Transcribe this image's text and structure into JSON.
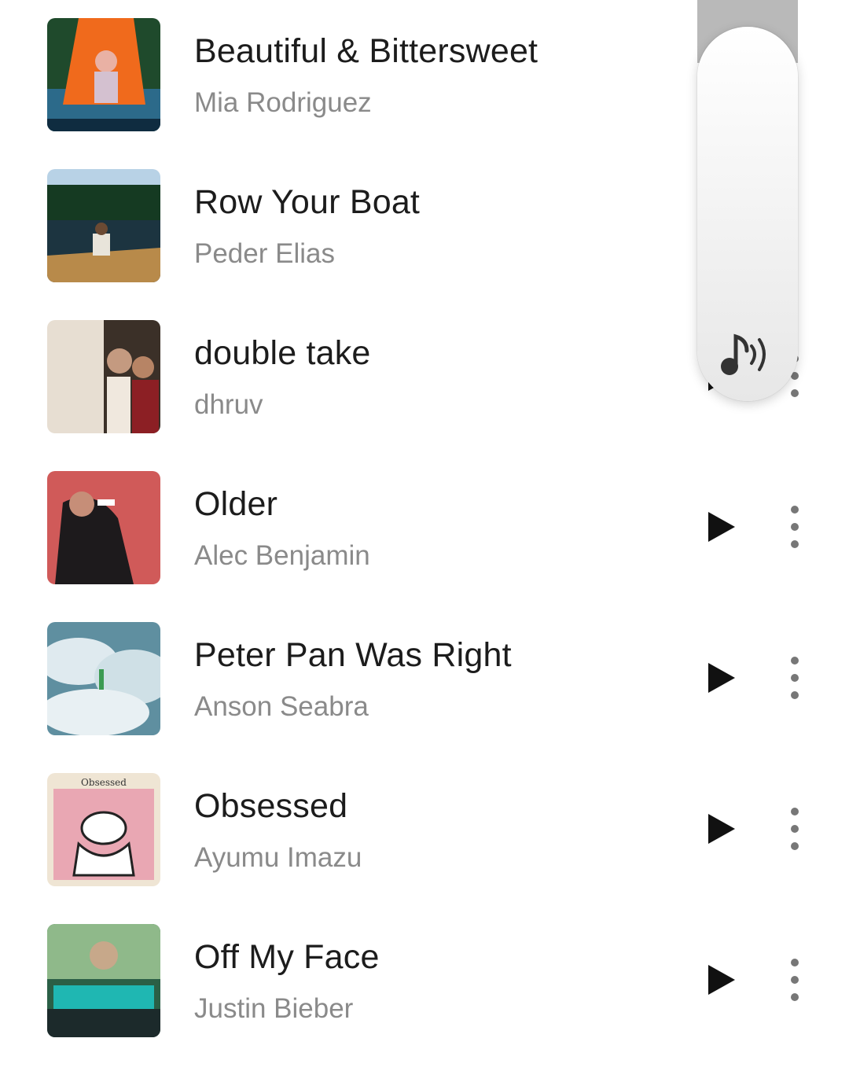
{
  "songs": [
    {
      "title": "Beautiful & Bittersweet",
      "artist": "Mia Rodriguez",
      "art_icon": "album-cover-beautiful-bittersweet"
    },
    {
      "title": "Row Your Boat",
      "artist": "Peder Elias",
      "art_icon": "album-cover-row-your-boat"
    },
    {
      "title": "double take",
      "artist": "dhruv",
      "art_icon": "album-cover-double-take"
    },
    {
      "title": "Older",
      "artist": "Alec Benjamin",
      "art_icon": "album-cover-older"
    },
    {
      "title": "Peter Pan Was Right",
      "artist": "Anson Seabra",
      "art_icon": "album-cover-peter-pan-was-right"
    },
    {
      "title": "Obsessed",
      "artist": "Ayumu Imazu",
      "art_icon": "album-cover-obsessed"
    },
    {
      "title": "Off My Face",
      "artist": "Justin Bieber",
      "art_icon": "album-cover-off-my-face"
    }
  ],
  "controls": {
    "play_icon": "play-icon",
    "more_icon": "more-vertical-icon"
  },
  "volume_overlay": {
    "icon": "music-volume-icon",
    "level": 0.08
  },
  "colors": {
    "title": "#1c1c1c",
    "artist": "#8a8a8a",
    "icon": "#111111"
  }
}
